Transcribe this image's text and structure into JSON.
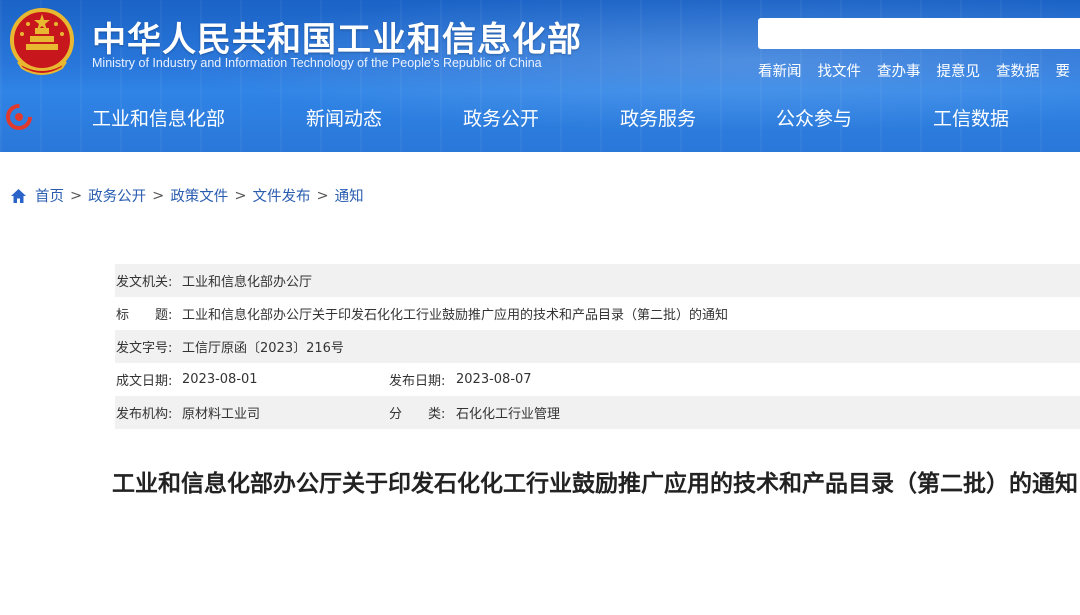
{
  "header": {
    "title": "中华人民共和国工业和信息化部",
    "subtitle": "Ministry of Industry and Information Technology of the People's Republic of China",
    "search_placeholder": "",
    "quick_links": [
      "看新闻",
      "找文件",
      "查办事",
      "提意见",
      "查数据",
      "要"
    ]
  },
  "nav": {
    "items": [
      "工业和信息化部",
      "新闻动态",
      "政务公开",
      "政务服务",
      "公众参与",
      "工信数据"
    ]
  },
  "breadcrumb": {
    "items": [
      "首页",
      "政务公开",
      "政策文件",
      "文件发布",
      "通知"
    ],
    "separator": ">"
  },
  "info": {
    "issuer_label": "发文机关:",
    "issuer": "工业和信息化部办公厅",
    "title_label": "标　　题:",
    "title": "工业和信息化部办公厅关于印发石化化工行业鼓励推广应用的技术和产品目录（第二批）的通知",
    "doc_no_label": "发文字号:",
    "doc_no": "工信厅原函〔2023〕216号",
    "created_label": "成文日期:",
    "created": "2023-08-01",
    "published_label": "发布日期:",
    "published": "2023-08-07",
    "agency_label": "发布机构:",
    "agency": "原材料工业司",
    "category_label": "分　　类:",
    "category": "石化化工行业管理"
  },
  "document": {
    "title": "工业和信息化部办公厅关于印发石化化工行业鼓励推广应用的技术和产品目录（第二批）的通知"
  },
  "colors": {
    "header_blue": "#2a78dc",
    "link_blue": "#2a5db0",
    "shaded_row": "#f1f1f1"
  }
}
